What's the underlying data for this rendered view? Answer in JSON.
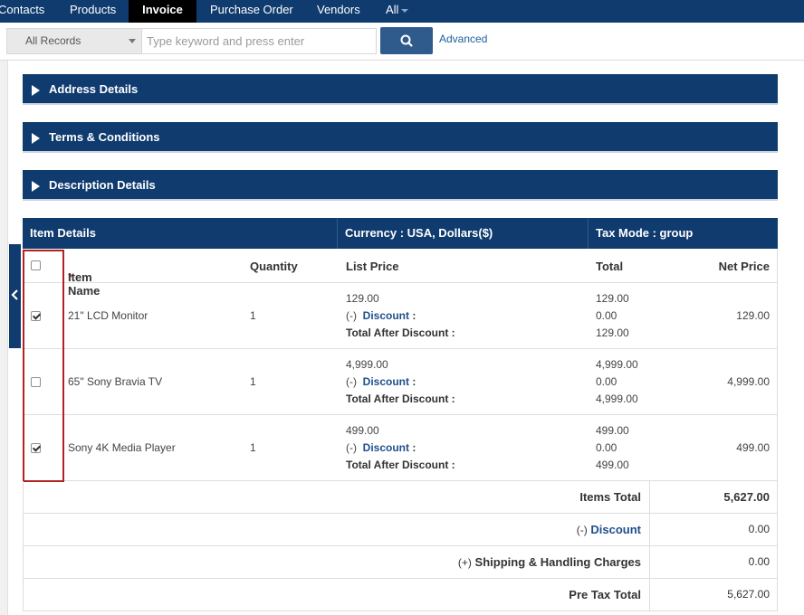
{
  "nav": {
    "tabs": [
      {
        "label": "Contacts"
      },
      {
        "label": "Products"
      },
      {
        "label": "Invoice"
      },
      {
        "label": "Purchase Order"
      },
      {
        "label": "Vendors"
      },
      {
        "label": "All"
      }
    ],
    "active_tab": "Invoice"
  },
  "search": {
    "scope": "All Records",
    "placeholder": "Type keyword and press enter",
    "button_icon": "search-icon",
    "advanced_label": "Advanced"
  },
  "sections": [
    {
      "title": "Address Details"
    },
    {
      "title": "Terms & Conditions"
    },
    {
      "title": "Description Details"
    }
  ],
  "item_details": {
    "header": {
      "title": "Item Details",
      "currency": "Currency : USA, Dollars($)",
      "tax_mode": "Tax Mode : group"
    },
    "columns": {
      "required_mark": "*",
      "item_name": "Item Name",
      "quantity": "Quantity",
      "list_price": "List Price",
      "total": "Total",
      "net_price": "Net Price"
    },
    "labels": {
      "discount_prefix": "(-)",
      "discount": "Discount",
      "discount_colon": ":",
      "total_after_discount": "Total After Discount :"
    },
    "rows": [
      {
        "checked": true,
        "name": "21\" LCD Monitor",
        "quantity": "1",
        "list_price": "129.00",
        "total": "129.00",
        "discount": "0.00",
        "after_discount": "129.00",
        "net_price": "129.00"
      },
      {
        "checked": false,
        "name": "65\" Sony Bravia TV",
        "quantity": "1",
        "list_price": "4,999.00",
        "total": "4,999.00",
        "discount": "0.00",
        "after_discount": "4,999.00",
        "net_price": "4,999.00"
      },
      {
        "checked": true,
        "name": "Sony 4K Media Player",
        "quantity": "1",
        "list_price": "499.00",
        "total": "499.00",
        "discount": "0.00",
        "after_discount": "499.00",
        "net_price": "499.00"
      }
    ]
  },
  "totals": {
    "items_total_label": "Items Total",
    "items_total": "5,627.00",
    "discount_prefix": "(-)",
    "discount_label": "Discount",
    "discount": "0.00",
    "shipping_prefix": "(+)",
    "shipping_label": "Shipping & Handling Charges",
    "shipping": "0.00",
    "pre_tax_label": "Pre Tax Total",
    "pre_tax": "5,627.00"
  },
  "colors": {
    "nav_bg": "#0f3b6e",
    "active_tab_bg": "#000000",
    "highlight_box": "#b22222",
    "link": "#1f5fa0"
  }
}
